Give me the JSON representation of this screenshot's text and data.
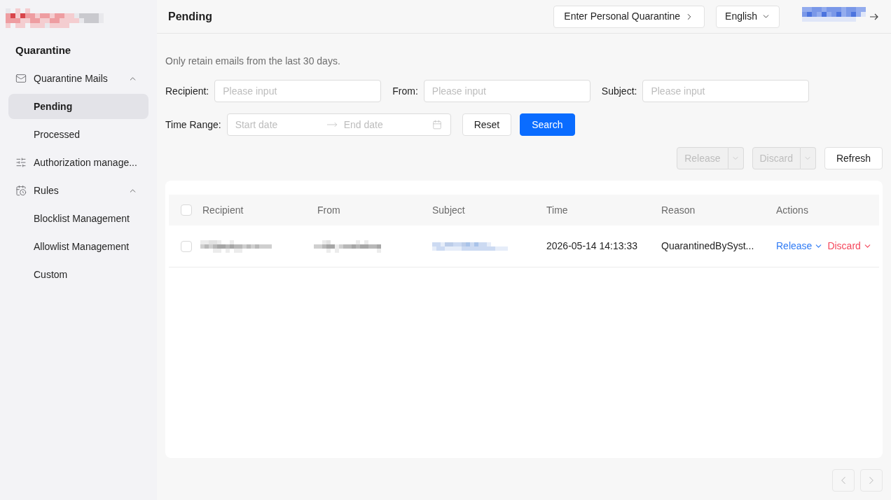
{
  "sidebar": {
    "title": "Quarantine",
    "items": [
      {
        "label": "Quarantine Mails",
        "kind": "group",
        "selected": false,
        "expanded": true,
        "children": [
          {
            "label": "Pending",
            "selected": true
          },
          {
            "label": "Processed",
            "selected": false
          }
        ]
      },
      {
        "label": "Authorization manage...",
        "kind": "link",
        "selected": false
      },
      {
        "label": "Rules",
        "kind": "group",
        "selected": false,
        "expanded": true,
        "children": [
          {
            "label": "Blocklist Management",
            "selected": false
          },
          {
            "label": "Allowlist Management",
            "selected": false
          },
          {
            "label": "Custom",
            "selected": false
          }
        ]
      }
    ]
  },
  "header": {
    "title": "Pending",
    "buttons": [
      {
        "label": "Enter Personal Quarantine",
        "kind": "link"
      },
      {
        "label": "English",
        "kind": "dropdown"
      }
    ]
  },
  "filters": {
    "note": "Only retain emails from the last 30 days.",
    "fields": [
      {
        "label": "Recipient:",
        "placeholder": "Please input"
      },
      {
        "label": "From:",
        "placeholder": "Please input"
      },
      {
        "label": "Subject:",
        "placeholder": "Please input"
      }
    ],
    "time_range": {
      "label": "Time Range:",
      "start_placeholder": "Start date",
      "end_placeholder": "End date"
    },
    "buttons": [
      {
        "label": "Reset",
        "kind": "default"
      },
      {
        "label": "Search",
        "kind": "primary"
      }
    ]
  },
  "toolbar": {
    "buttons": [
      {
        "label": "Release",
        "kind": "split",
        "disabled": true
      },
      {
        "label": "Discard",
        "kind": "split",
        "disabled": true
      },
      {
        "label": "Refresh",
        "kind": "default",
        "disabled": false
      }
    ]
  },
  "table": {
    "select_all": {
      "checked": false
    },
    "columns": [
      "Recipient",
      "From",
      "Subject",
      "Time",
      "Reason",
      "Actions"
    ],
    "rows": [
      {
        "checked": false,
        "time": "2026-05-14 14:13:33",
        "reason": "QuarantinedBySyst...",
        "actions": [
          {
            "label": "Release",
            "color": "#2f7bf5"
          },
          {
            "label": "Discard",
            "color": "#f5475b"
          }
        ]
      }
    ]
  },
  "pagination": {
    "prev": {
      "disabled": true
    },
    "next": {
      "disabled": true
    }
  }
}
